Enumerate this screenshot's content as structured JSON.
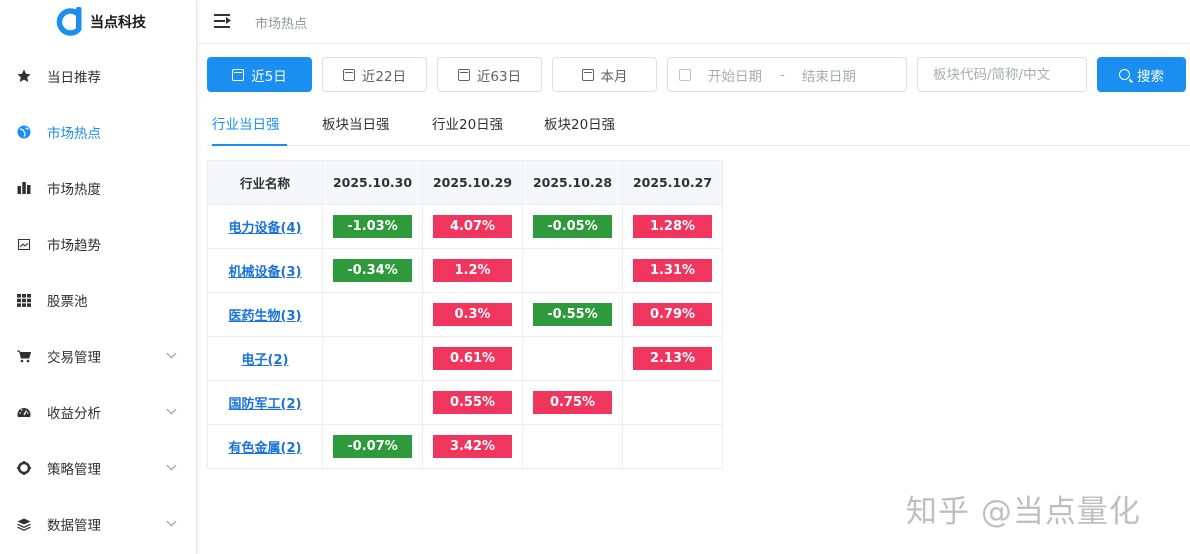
{
  "app": {
    "logo_text": "当点科技",
    "brand_color": "#1a8ff0"
  },
  "sidebar": {
    "items": [
      {
        "label": "当日推荐",
        "icon": "star-icon",
        "active": false,
        "expandable": false
      },
      {
        "label": "市场热点",
        "icon": "globe-icon",
        "active": true,
        "expandable": false
      },
      {
        "label": "市场热度",
        "icon": "bar-chart-icon",
        "active": false,
        "expandable": false
      },
      {
        "label": "市场趋势",
        "icon": "trend-image-icon",
        "active": false,
        "expandable": false
      },
      {
        "label": "股票池",
        "icon": "grid-icon",
        "active": false,
        "expandable": false
      },
      {
        "label": "交易管理",
        "icon": "cart-icon",
        "active": false,
        "expandable": true
      },
      {
        "label": "收益分析",
        "icon": "gauge-icon",
        "active": false,
        "expandable": true
      },
      {
        "label": "策略管理",
        "icon": "target-icon",
        "active": false,
        "expandable": true
      },
      {
        "label": "数据管理",
        "icon": "layers-icon",
        "active": false,
        "expandable": true
      }
    ]
  },
  "header": {
    "breadcrumb": "市场热点"
  },
  "toolbar": {
    "btn_5d": "近5日",
    "btn_22d": "近22日",
    "btn_63d": "近63日",
    "btn_month": "本月",
    "start_placeholder": "开始日期",
    "range_separator": "-",
    "end_placeholder": "结束日期",
    "search_placeholder": "板块代码/简称/中文",
    "search_button": "搜索"
  },
  "tabs": [
    "行业当日强",
    "板块当日强",
    "行业20日强",
    "板块20日强"
  ],
  "table": {
    "headers": [
      "行业名称",
      "2025.10.30",
      "2025.10.29",
      "2025.10.28",
      "2025.10.27"
    ],
    "rows": [
      {
        "name": "电力设备(4)",
        "cells": [
          "-1.03%",
          "4.07%",
          "-0.05%",
          "1.28%"
        ]
      },
      {
        "name": "机械设备(3)",
        "cells": [
          "-0.34%",
          "1.2%",
          "",
          "1.31%"
        ]
      },
      {
        "name": "医药生物(3)",
        "cells": [
          "",
          "0.3%",
          "-0.55%",
          "0.79%"
        ]
      },
      {
        "name": "电子(2)",
        "cells": [
          "",
          "0.61%",
          "",
          "2.13%"
        ]
      },
      {
        "name": "国防军工(2)",
        "cells": [
          "",
          "0.55%",
          "0.75%",
          ""
        ]
      },
      {
        "name": "有色金属(2)",
        "cells": [
          "-0.07%",
          "3.42%",
          "",
          ""
        ]
      }
    ],
    "up_color": "#f0365f",
    "down_color": "#2e9a3b"
  },
  "watermark": "知乎 @当点量化"
}
